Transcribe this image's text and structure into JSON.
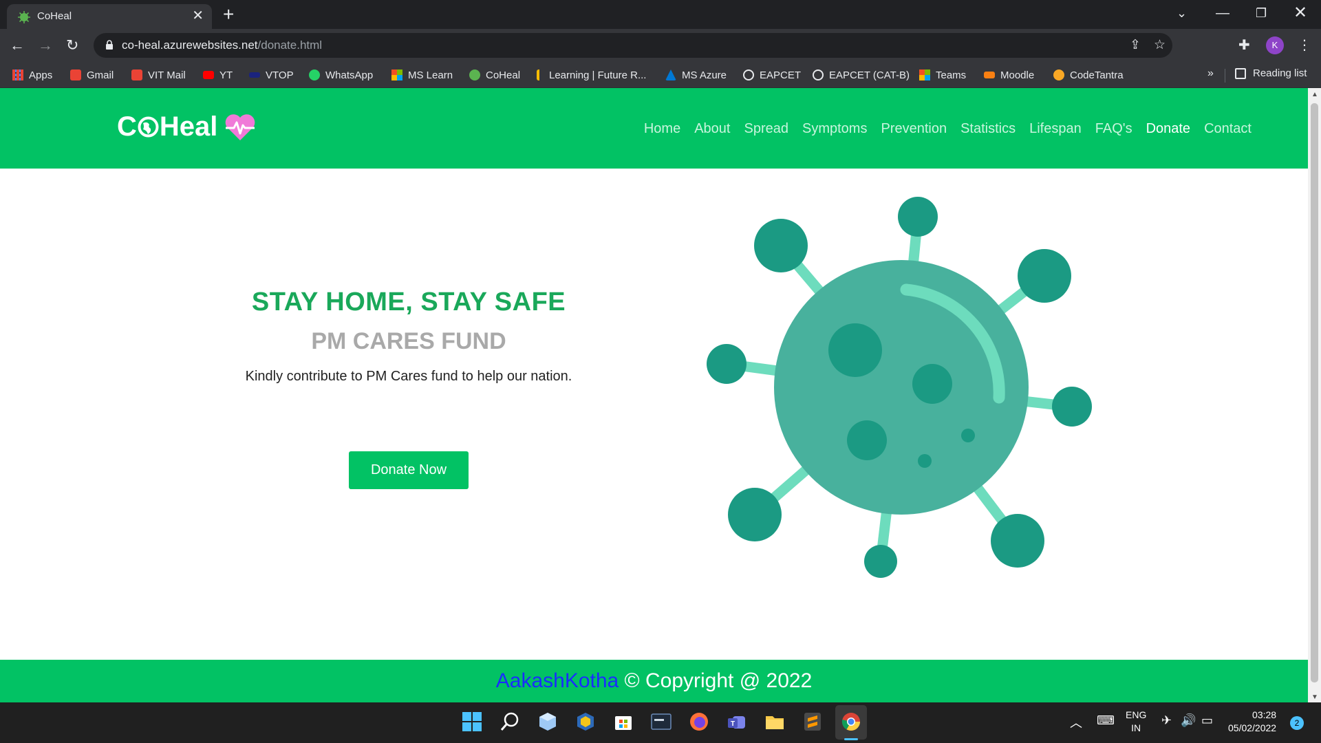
{
  "browser": {
    "tab_title": "CoHeal",
    "url_domain": "co-heal.azurewebsites.net",
    "url_path": "/donate.html",
    "profile_initial": "K",
    "bookmarks": [
      {
        "label": "Apps",
        "icon": "apps-grid-icon",
        "color": "#4285f4"
      },
      {
        "label": "Gmail",
        "icon": "gmail-icon",
        "color": "#ea4335"
      },
      {
        "label": "VIT Mail",
        "icon": "vit-mail-icon",
        "color": "#ea4335"
      },
      {
        "label": "YT",
        "icon": "youtube-icon",
        "color": "#ff0000"
      },
      {
        "label": "VTOP",
        "icon": "vtop-icon",
        "color": "#1a237e"
      },
      {
        "label": "WhatsApp",
        "icon": "whatsapp-icon",
        "color": "#25d366"
      },
      {
        "label": "MS Learn",
        "icon": "microsoft-icon",
        "color": "#f25022"
      },
      {
        "label": "CoHeal",
        "icon": "coheal-icon",
        "color": "#4caf50"
      },
      {
        "label": "Learning | Future R...",
        "icon": "learning-icon",
        "color": "#fbbc04"
      },
      {
        "label": "MS Azure",
        "icon": "azure-icon",
        "color": "#0078d4"
      },
      {
        "label": "EAPCET",
        "icon": "globe-icon",
        "color": "#e8eaed"
      },
      {
        "label": "EAPCET (CAT-B)",
        "icon": "globe-icon",
        "color": "#e8eaed"
      },
      {
        "label": "Teams",
        "icon": "microsoft-icon",
        "color": "#f25022"
      },
      {
        "label": "Moodle",
        "icon": "moodle-icon",
        "color": "#f98012"
      },
      {
        "label": "CodeTantra",
        "icon": "codetantra-icon",
        "color": "#f9a825"
      }
    ],
    "more_label": "»",
    "reading_list_label": "Reading list"
  },
  "site": {
    "logo_text_1": "C",
    "logo_text_2": "Heal",
    "nav": [
      {
        "label": "Home",
        "active": false
      },
      {
        "label": "About",
        "active": false
      },
      {
        "label": "Spread",
        "active": false
      },
      {
        "label": "Symptoms",
        "active": false
      },
      {
        "label": "Prevention",
        "active": false
      },
      {
        "label": "Statistics",
        "active": false
      },
      {
        "label": "Lifespan",
        "active": false
      },
      {
        "label": "FAQ's",
        "active": false
      },
      {
        "label": "Donate",
        "active": true
      },
      {
        "label": "Contact",
        "active": false
      }
    ],
    "hero": {
      "title": "STAY HOME, STAY SAFE",
      "subtitle": "PM CARES FUND",
      "text": "Kindly contribute to PM Cares fund to help our nation.",
      "button": "Donate Now"
    },
    "footer": {
      "author": "AakashKotha",
      "copyright": " © Copyright @ 2022"
    },
    "colors": {
      "brand_green": "#02c264",
      "title_green": "#1aa85a",
      "virus_body": "#48b19d",
      "virus_dark": "#1b9a83",
      "virus_light": "#6ddcbd",
      "heart_pink": "#f07ad8"
    }
  },
  "taskbar": {
    "lang_1": "ENG",
    "lang_2": "IN",
    "time": "03:28",
    "date": "05/02/2022",
    "notifications": "2"
  }
}
